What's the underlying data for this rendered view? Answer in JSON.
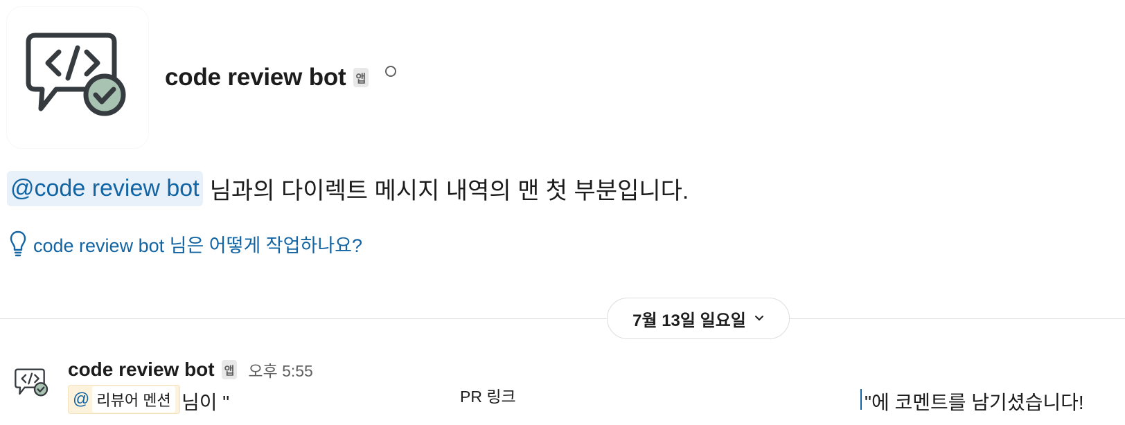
{
  "bot": {
    "name": "code review bot",
    "app_badge": "앱"
  },
  "intro": {
    "mention": "@code review bot",
    "text": " 님과의 다이렉트 메시지 내역의 맨 첫 부분입니다."
  },
  "howto_link": "code review bot 님은 어떻게 작업하나요?",
  "date_divider": {
    "label": "7월 13일 일요일"
  },
  "message": {
    "sender": "code review bot",
    "app_badge": "앱",
    "time": "오후 5:55",
    "reviewer_at": "@",
    "reviewer_label": "리뷰어 멘션",
    "text_before": "님이 \"",
    "pr_link": "PR 링크",
    "text_after": "\"에 코멘트를 남기셨습니다!"
  },
  "colors": {
    "link": "#1264a3",
    "mention_bg": "#e8f1fa",
    "avatar_check": "#a8c3b1",
    "text": "#1d1c1d"
  },
  "icons": {
    "bot_avatar": "code-review-bot-avatar",
    "presence": "presence-away-icon",
    "lightbulb": "lightbulb-icon",
    "chevron": "chevron-down-icon"
  }
}
